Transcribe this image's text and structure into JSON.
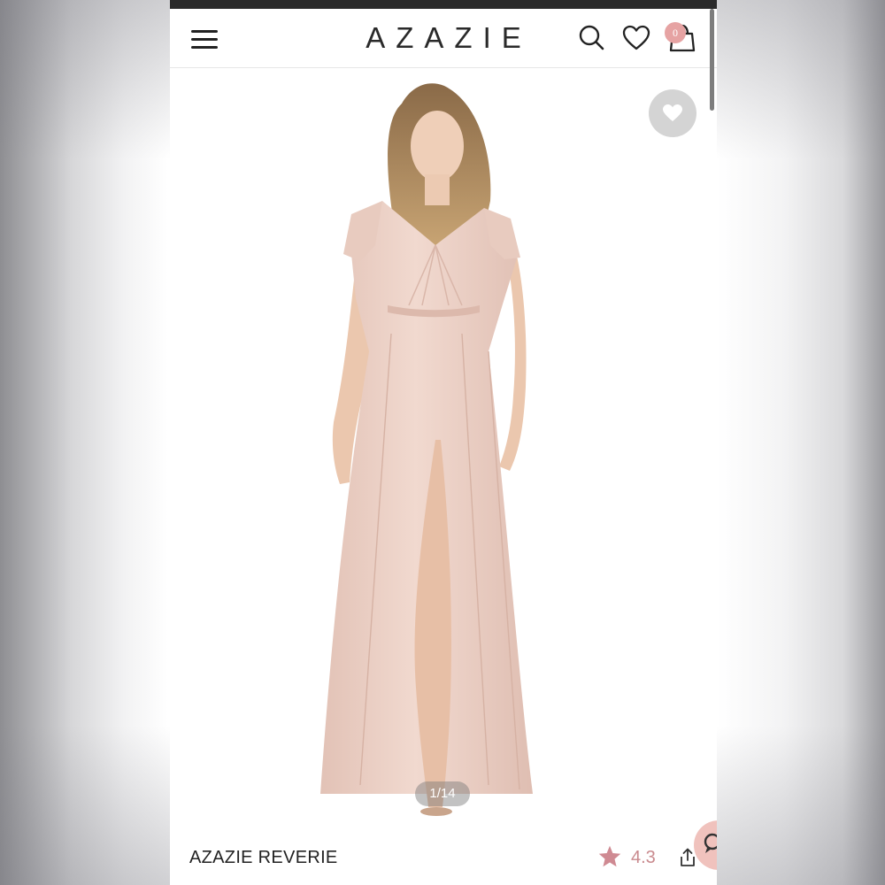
{
  "header": {
    "logo": "AZAZIE",
    "cart_count": "0"
  },
  "icons": {
    "menu": "hamburger-menu-icon",
    "search": "search-icon",
    "wishlist": "heart-icon",
    "cart": "shopping-bag-icon",
    "favorite": "heart-icon",
    "rating": "star-icon",
    "share": "share-icon",
    "chat": "chat-icon"
  },
  "gallery": {
    "pager": "1/14"
  },
  "product": {
    "name": "AZAZIE REVERIE",
    "rating": "4.3"
  },
  "colors": {
    "dress": "#ecd0c6",
    "badge": "#e6a3a3",
    "rating": "#c98a8e"
  }
}
